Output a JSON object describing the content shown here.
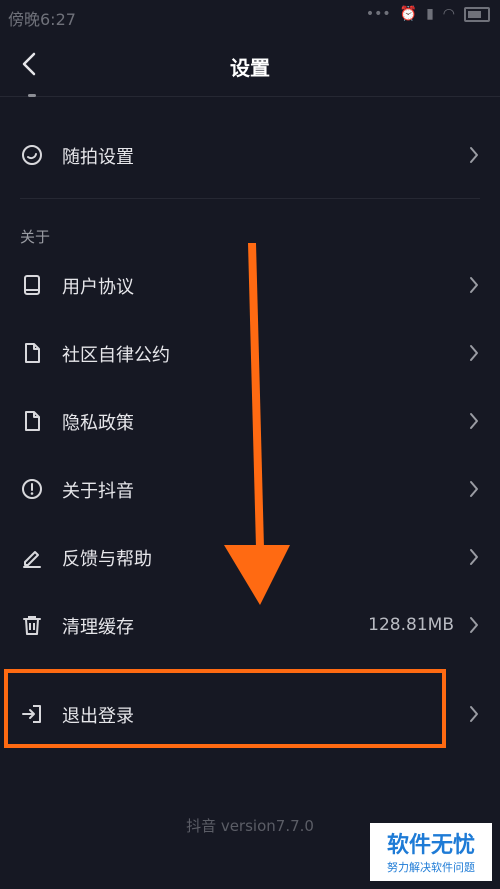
{
  "status_bar": {
    "time": "傍晚6:27"
  },
  "header": {
    "title": "设置"
  },
  "rows": [
    {
      "label": "随拍设置",
      "icon": "random-shoot-icon"
    },
    {
      "label": "用户协议",
      "icon": "book-icon"
    },
    {
      "label": "社区自律公约",
      "icon": "document-icon"
    },
    {
      "label": "隐私政策",
      "icon": "document-icon"
    },
    {
      "label": "关于抖音",
      "icon": "info-icon"
    },
    {
      "label": "反馈与帮助",
      "icon": "edit-icon"
    },
    {
      "label": "清理缓存",
      "icon": "trash-icon",
      "value": "128.81MB"
    },
    {
      "label": "退出登录",
      "icon": "logout-icon"
    }
  ],
  "section": {
    "about_label": "关于"
  },
  "footer": {
    "version": "抖音 version7.7.0"
  },
  "annotation": {
    "color": "#ff6a12"
  },
  "watermark": {
    "title": "软件无忧",
    "subtitle": "努力解决软件问题"
  },
  "colors": {
    "background": "#161823",
    "text": "#e6e6ea",
    "muted": "#9a9ca3",
    "accent": "#ff6a12"
  }
}
